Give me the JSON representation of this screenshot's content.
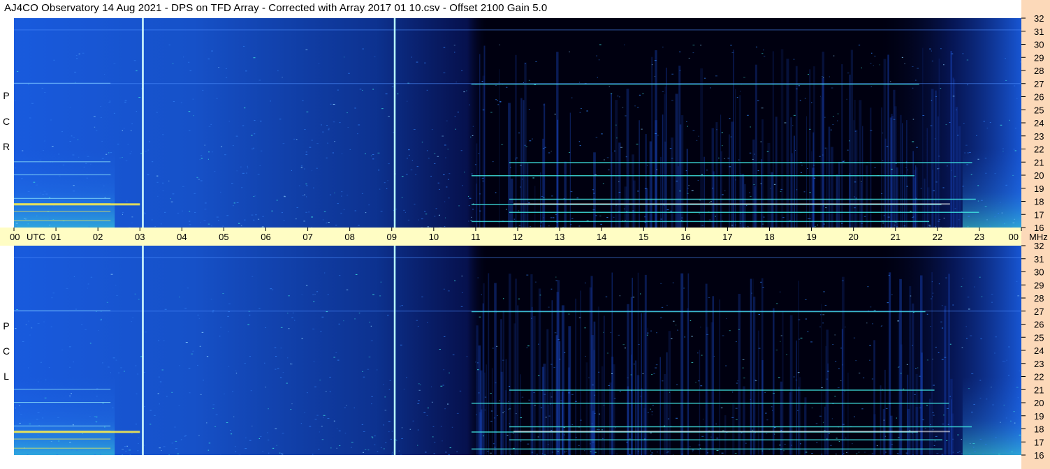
{
  "title": "AJ4CO Observatory  14 Aug 2021  -  DPS on TFD Array  -  Corrected with Array 2017 01 10.csv  -  Offset 2100  Gain 5.0",
  "chart_data": {
    "type": "heatmap",
    "title": "AJ4CO Observatory  14 Aug 2021  -  DPS on TFD Array  -  Corrected with Array 2017 01 10.csv  -  Offset 2100  Gain 5.0",
    "xlabel": "UTC",
    "ylabel": "MHz",
    "x_ticks": [
      "00",
      "01",
      "02",
      "03",
      "04",
      "05",
      "06",
      "07",
      "08",
      "09",
      "10",
      "11",
      "12",
      "13",
      "14",
      "15",
      "16",
      "17",
      "18",
      "19",
      "20",
      "21",
      "22",
      "23",
      "00"
    ],
    "xlim": [
      0,
      24
    ],
    "ylim": [
      16,
      32
    ],
    "y_ticks": [
      16,
      17,
      18,
      19,
      20,
      21,
      22,
      23,
      24,
      25,
      26,
      27,
      28,
      29,
      30,
      31,
      32
    ],
    "panels": [
      {
        "name": "R C P",
        "letters": [
          "R",
          "C",
          "P"
        ]
      },
      {
        "name": "L C P",
        "letters": [
          "L",
          "C",
          "P"
        ]
      }
    ],
    "vertical_markers_utc": [
      3.05,
      9.05
    ],
    "bright_lines_mhz": [
      16.5,
      17.2,
      17.8,
      18.2,
      20.0,
      21.0,
      27.0
    ],
    "colors": {
      "background": "#000010",
      "low": "#0a1a90",
      "mid": "#1f6ff2",
      "high": "#3fe3e0",
      "peak": "#fff04a",
      "axis_band": "#fffdc4",
      "freq_strip": "#fcd9b9"
    }
  }
}
